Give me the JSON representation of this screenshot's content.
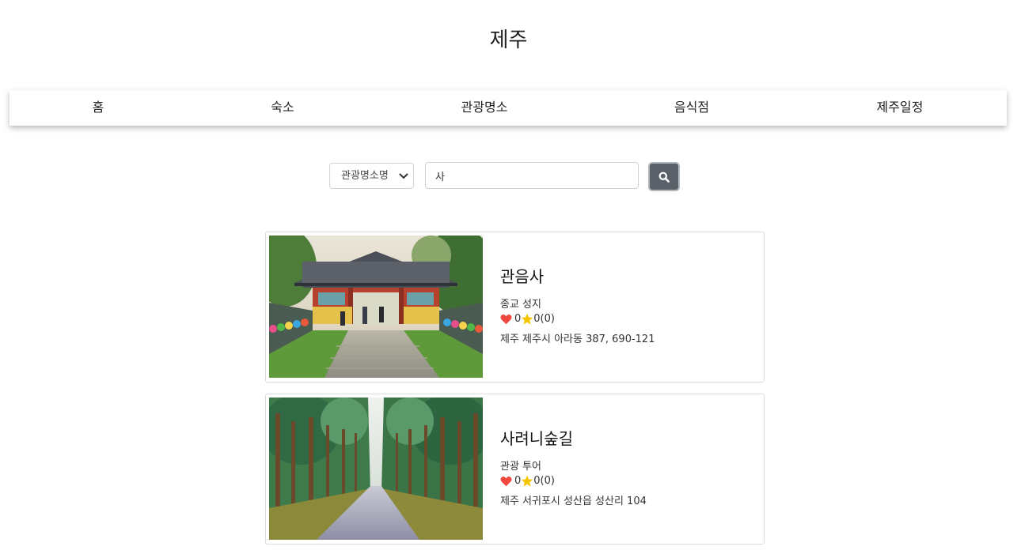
{
  "site_title": "제주",
  "nav": {
    "items": [
      {
        "label": "홈"
      },
      {
        "label": "숙소"
      },
      {
        "label": "관광명소"
      },
      {
        "label": "음식점"
      },
      {
        "label": "제주일정"
      }
    ]
  },
  "search": {
    "select_value": "관광명소명",
    "query": "사",
    "button_icon": "search-icon"
  },
  "results": [
    {
      "name": "관음사",
      "category": "종교 성지",
      "likes": "0",
      "rating": "0(0)",
      "address": "제주 제주시 아라동 387, 690-121",
      "image_icon": "temple-gate-photo"
    },
    {
      "name": "사려니숲길",
      "category": "관광 투어",
      "likes": "0",
      "rating": "0(0)",
      "address": "제주 서귀포시 성산읍 성산리 104",
      "image_icon": "forest-path-photo"
    }
  ],
  "colors": {
    "heart": "#f0483e",
    "star": "#f7c500",
    "search_button": "#5a6168"
  }
}
